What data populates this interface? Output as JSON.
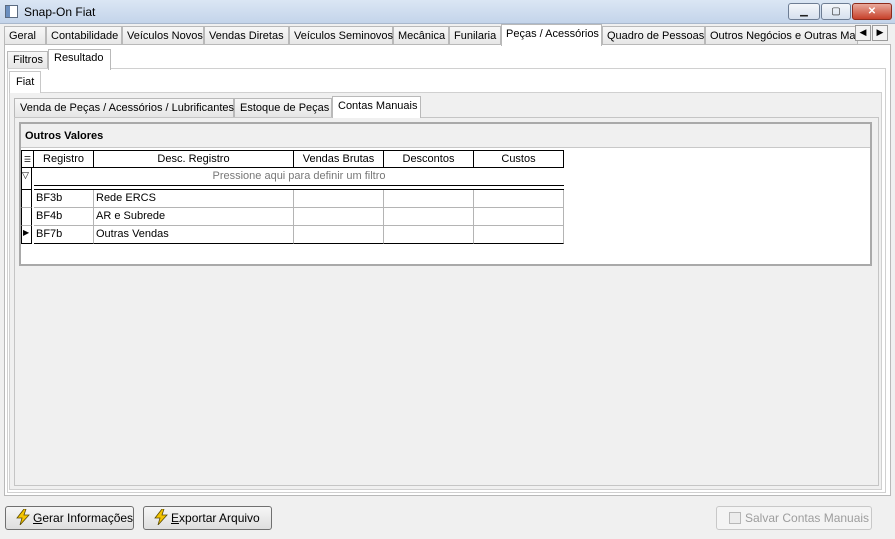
{
  "window": {
    "title": "Snap-On Fiat"
  },
  "main_tabs": [
    "Geral",
    "Contabilidade",
    "Veículos Novos",
    "Vendas Diretas",
    "Veículos Seminovos",
    "Mecânica",
    "Funilaria",
    "Peças / Acessórios",
    "Quadro de Pessoas",
    "Outros Negócios e Outras Mar"
  ],
  "main_tab_active": "Peças / Acessórios",
  "sub_tabs": [
    "Filtros",
    "Resultado"
  ],
  "sub_tab_active": "Resultado",
  "brand_tab": "Fiat",
  "inner_tabs": [
    "Venda de Peças / Acessórios / Lubrificantes",
    "Estoque de Peças",
    "Contas Manuais"
  ],
  "inner_tab_active": "Contas Manuais",
  "group": {
    "title": "Outros Valores",
    "columns": [
      "Registro",
      "Desc. Registro",
      "Vendas Brutas",
      "Descontos",
      "Custos"
    ],
    "filter_placeholder": "Pressione aqui para definir um filtro",
    "rows": [
      {
        "registro": "BF3b",
        "desc": "Rede ERCS",
        "vendas": "",
        "descontos": "",
        "custos": ""
      },
      {
        "registro": "BF4b",
        "desc": "AR e Subrede",
        "vendas": "",
        "descontos": "",
        "custos": ""
      },
      {
        "registro": "BF7b",
        "desc": "Outras Vendas",
        "vendas": "",
        "descontos": "",
        "custos": ""
      }
    ],
    "current_row": 2
  },
  "buttons": {
    "gerar_prefix": "G",
    "gerar_rest": "erar Informações",
    "exportar_prefix": "E",
    "exportar_rest": "xportar Arquivo",
    "salvar": "Salvar Contas Manuais"
  },
  "colors": {
    "accent": "#f4c400",
    "disabled_text": "#9d9d9d"
  },
  "icons": [
    "app-icon",
    "minimize-icon",
    "maximize-icon",
    "close-icon",
    "scroll-left-icon",
    "scroll-right-icon",
    "column-chooser-icon",
    "filter-icon",
    "row-pointer-icon",
    "lightning-icon",
    "save-icon"
  ]
}
